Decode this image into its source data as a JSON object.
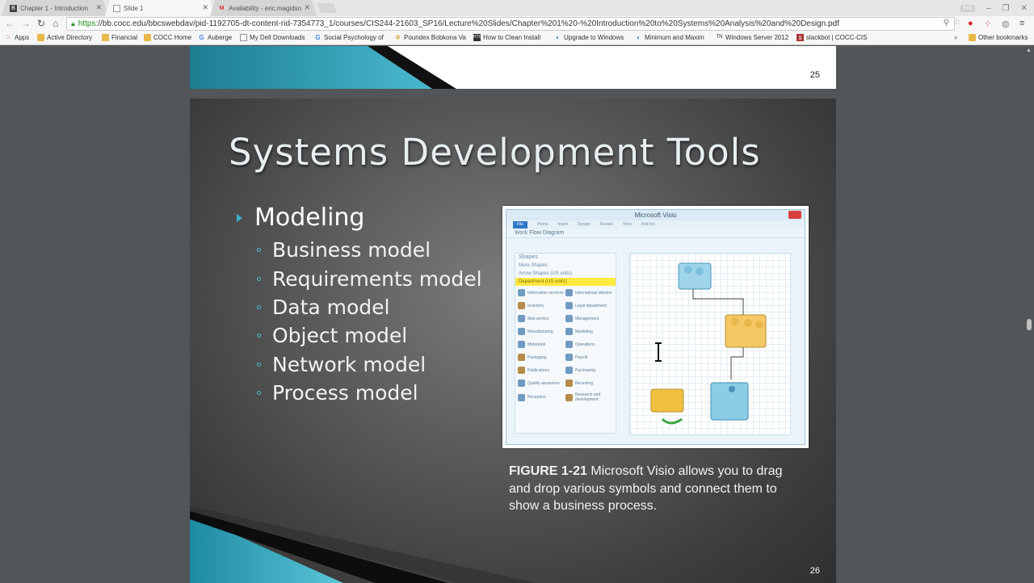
{
  "browser": {
    "tabs": [
      {
        "title": "Chapter 1 - Introduction",
        "active": false
      },
      {
        "title": "Slide 1",
        "active": true
      },
      {
        "title": "Availability - eric.magidso",
        "active": false
      }
    ],
    "user_chip": "Eric",
    "url_scheme": "https",
    "url_rest": "://bb.cocc.edu/bbcswebdav/pid-1192705-dt-content-rid-7354773_1/courses/CIS244-21603_SP16/Lecture%20Slides/Chapter%201%20-%20Introduction%20to%20Systems%20Analysis%20and%20Design.pdf",
    "bookmarks": [
      "Apps",
      "Active Directory",
      "Financial",
      "COCC Home",
      "Auberge",
      "My Dell Downloads",
      "Social Psychology of",
      "Poundex Bobkona Va",
      "How to Clean Install",
      "Upgrade to Windows",
      "Minimum and Maxim",
      "Windows Server 2012",
      "slackbot | COCC-CIS"
    ],
    "other_bookmarks": "Other bookmarks",
    "chevron": "»"
  },
  "pdf": {
    "prev_page_number": "25",
    "page_number": "26"
  },
  "slide": {
    "title": "Systems Development Tools",
    "main_bullet": "Modeling",
    "sub_bullets": [
      "Business model",
      "Requirements model",
      "Data model",
      "Object model",
      "Network model",
      "Process model"
    ],
    "figure_label": "FIGURE 1-21",
    "figure_caption": " Microsoft Visio allows you to drag and drop various symbols and connect them to show a business process.",
    "visio": {
      "window_title": "Microsoft Visio",
      "ribbon": [
        "File",
        "Home",
        "Insert",
        "Design",
        "Review",
        "View",
        "Add-Ins"
      ],
      "doc_title": "Work Flow Diagram",
      "shapes_header": "Shapes",
      "more_shapes": "More Shapes",
      "stencils": [
        "Arrow Shapes (US units)",
        "Department (US units)"
      ],
      "shape_items": [
        "Information services",
        "International division",
        "Inventory",
        "Legal department",
        "Mail service",
        "Management",
        "Manufacturing",
        "Marketing",
        "Motorpool",
        "Operations",
        "Packaging",
        "Payroll",
        "Publications",
        "Purchasing",
        "Quality assurance",
        "Receiving",
        "Reception",
        "Research and development"
      ]
    }
  },
  "colors": {
    "accent": "#3bb0c9",
    "slide_bg": "#5a5a5a",
    "viewer_bg": "#525659"
  }
}
